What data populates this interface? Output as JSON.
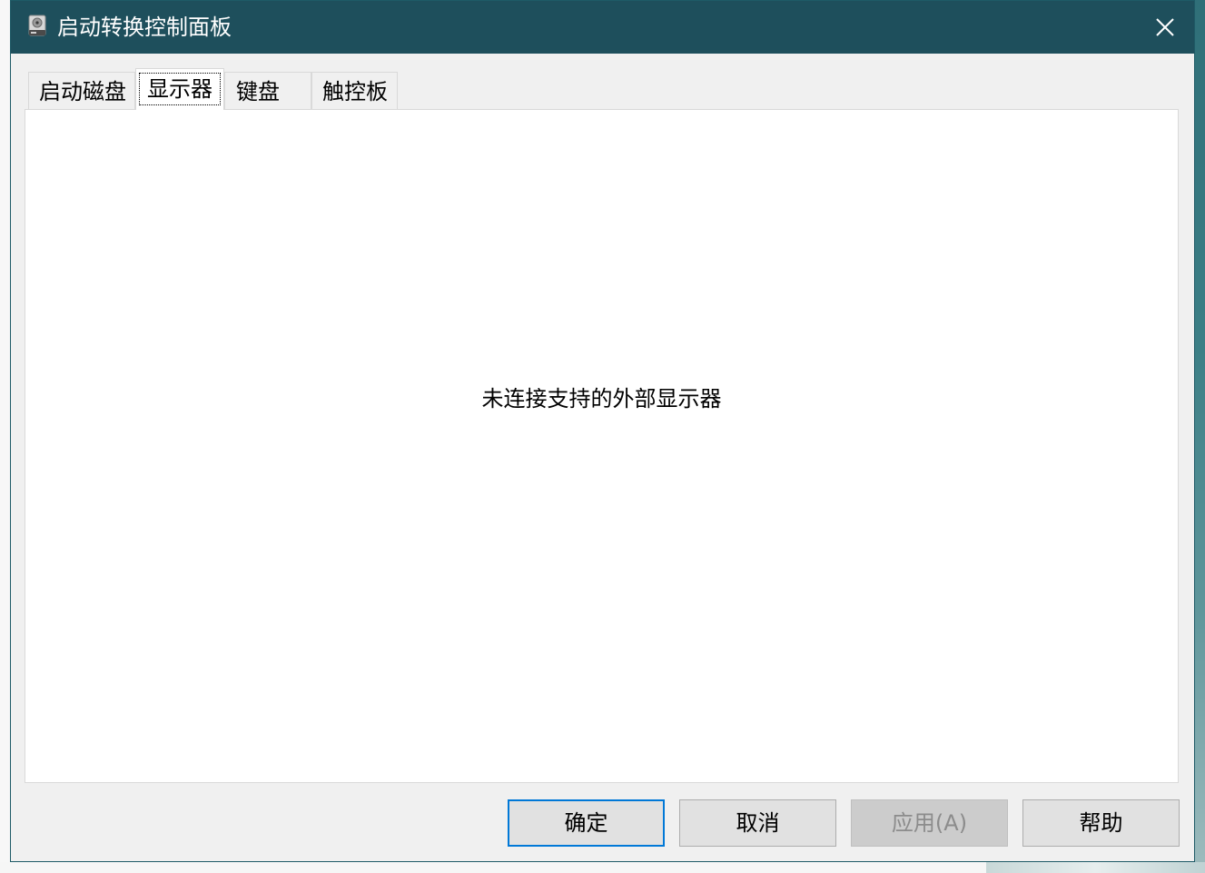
{
  "window": {
    "title": "启动转换控制面板",
    "icon": "disk-drive-icon",
    "close_icon": "close-icon"
  },
  "tabs": [
    {
      "label": "启动磁盘",
      "active": false
    },
    {
      "label": "显示器",
      "active": true
    },
    {
      "label": "键盘",
      "active": false
    },
    {
      "label": "触控板",
      "active": false
    }
  ],
  "panel": {
    "message": "未连接支持的外部显示器"
  },
  "buttons": {
    "ok": "确定",
    "cancel": "取消",
    "apply": "应用(A)",
    "help": "帮助"
  },
  "colors": {
    "titlebar": "#1e4f5c",
    "focus_border": "#0078d7"
  }
}
